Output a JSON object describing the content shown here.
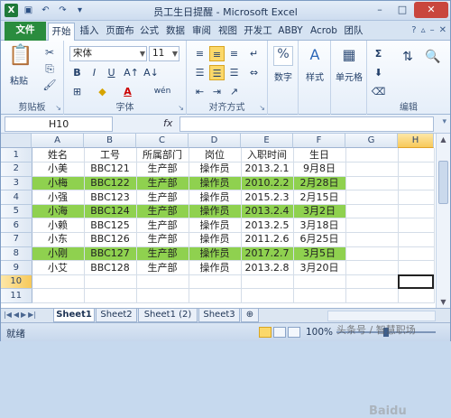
{
  "window": {
    "title": "员工生日提醒 - Microsoft Excel"
  },
  "qat": {
    "excel_icon": "X",
    "save_icon": "save-icon",
    "undo_icon": "↶",
    "redo_icon": "↷"
  },
  "window_controls": {
    "minimize": "–",
    "maximize": "□",
    "close": "✕"
  },
  "tabs": [
    {
      "label": "文件"
    },
    {
      "label": "开始"
    },
    {
      "label": "插入"
    },
    {
      "label": "页面布"
    },
    {
      "label": "公式"
    },
    {
      "label": "数据"
    },
    {
      "label": "审阅"
    },
    {
      "label": "视图"
    },
    {
      "label": "开发工"
    },
    {
      "label": "ABBY"
    },
    {
      "label": "Acrob"
    },
    {
      "label": "团队"
    }
  ],
  "ribbon": {
    "clipboard": {
      "paste_label": "粘贴",
      "group_label": "剪贴板"
    },
    "font": {
      "font_name": "宋体",
      "font_size": "11",
      "bold": "B",
      "italic": "I",
      "underline": "U",
      "group_label": "字体",
      "font_color_letter": "A",
      "wen": "wén"
    },
    "alignment": {
      "group_label": "对齐方式"
    },
    "number": {
      "label": "数字",
      "symbol": "%"
    },
    "styles": {
      "label": "样式"
    },
    "cells": {
      "label": "单元格"
    },
    "editing": {
      "group_label": "编辑",
      "sum": "Σ"
    }
  },
  "formula_bar": {
    "name_box": "H10",
    "fx": "fx",
    "formula": ""
  },
  "columns": [
    "A",
    "B",
    "C",
    "D",
    "E",
    "F",
    "G",
    "H"
  ],
  "rows": [
    {
      "num": "1",
      "cells": [
        "姓名",
        "工号",
        "所属部门",
        "岗位",
        "入职时间",
        "生日"
      ],
      "hl": false
    },
    {
      "num": "2",
      "cells": [
        "小美",
        "BBC121",
        "生产部",
        "操作员",
        "2013.2.1",
        "9月8日"
      ],
      "hl": false
    },
    {
      "num": "3",
      "cells": [
        "小梅",
        "BBC122",
        "生产部",
        "操作员",
        "2010.2.2",
        "2月28日"
      ],
      "hl": true
    },
    {
      "num": "4",
      "cells": [
        "小强",
        "BBC123",
        "生产部",
        "操作员",
        "2015.2.3",
        "2月15日"
      ],
      "hl": false
    },
    {
      "num": "5",
      "cells": [
        "小海",
        "BBC124",
        "生产部",
        "操作员",
        "2013.2.4",
        "3月2日"
      ],
      "hl": true
    },
    {
      "num": "6",
      "cells": [
        "小赖",
        "BBC125",
        "生产部",
        "操作员",
        "2013.2.5",
        "3月18日"
      ],
      "hl": false
    },
    {
      "num": "7",
      "cells": [
        "小东",
        "BBC126",
        "生产部",
        "操作员",
        "2011.2.6",
        "6月25日"
      ],
      "hl": false
    },
    {
      "num": "8",
      "cells": [
        "小刚",
        "BBC127",
        "生产部",
        "操作员",
        "2017.2.7",
        "3月5日"
      ],
      "hl": true
    },
    {
      "num": "9",
      "cells": [
        "小艾",
        "BBC128",
        "生产部",
        "操作员",
        "2013.2.8",
        "3月20日"
      ],
      "hl": false
    },
    {
      "num": "10",
      "cells": [
        "",
        "",
        "",
        "",
        "",
        ""
      ],
      "hl": false
    },
    {
      "num": "11",
      "cells": [
        "",
        "",
        "",
        "",
        "",
        ""
      ],
      "hl": false
    }
  ],
  "sheets": [
    {
      "label": "Sheet1"
    },
    {
      "label": "Sheet2"
    },
    {
      "label": "Sheet1 (2)"
    },
    {
      "label": "Sheet3"
    }
  ],
  "status": {
    "ready": "就绪",
    "zoom": "100%"
  },
  "watermark": {
    "text": "头条号 / 智慧职场",
    "baidu": "Baidu"
  },
  "colors": {
    "highlight": "#8fd14f",
    "file_tab": "#2a8c3e"
  }
}
